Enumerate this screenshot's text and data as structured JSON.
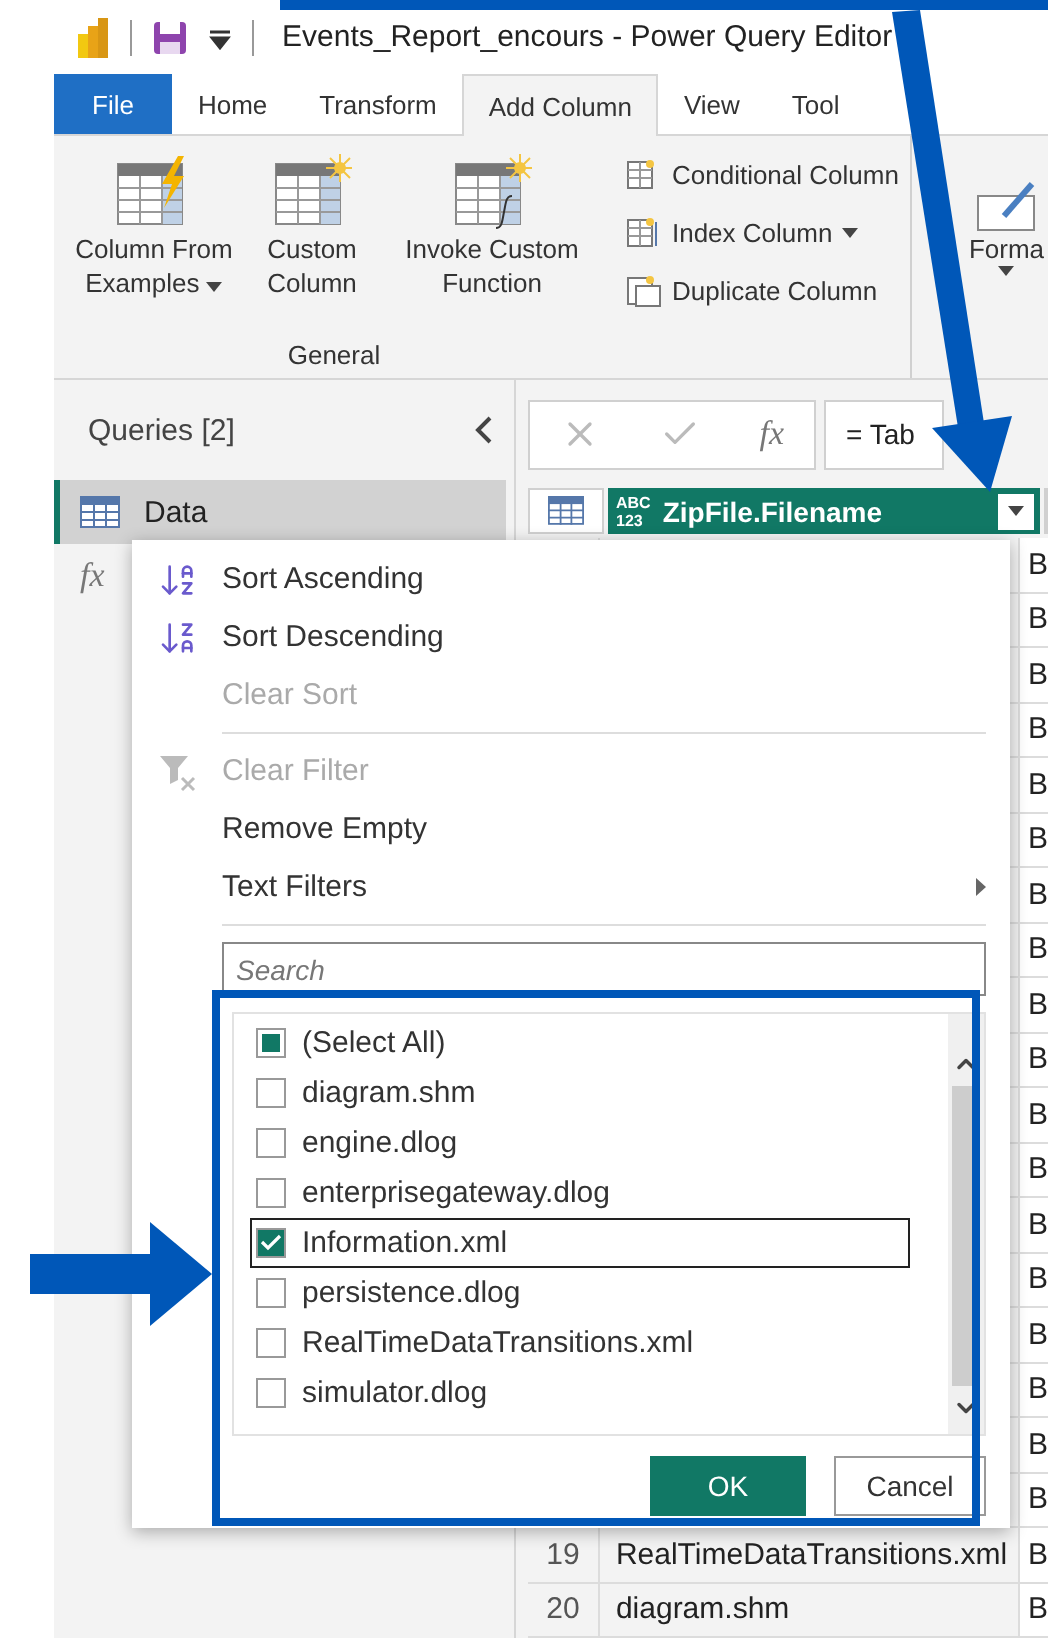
{
  "window": {
    "title": "Events_Report_encours - Power Query Editor"
  },
  "tabs": [
    {
      "label": "File",
      "kind": "file",
      "selected": false
    },
    {
      "label": "Home",
      "kind": "tab",
      "selected": false
    },
    {
      "label": "Transform",
      "kind": "tab",
      "selected": false
    },
    {
      "label": "Add Column",
      "kind": "tab",
      "selected": true
    },
    {
      "label": "View",
      "kind": "tab",
      "selected": false
    },
    {
      "label": "Tool",
      "kind": "tab",
      "selected": false
    }
  ],
  "ribbon": {
    "large_buttons": [
      {
        "label": "Column From Examples",
        "kind": "examples",
        "dropdown": true
      },
      {
        "label": "Custom Column",
        "kind": "custom",
        "dropdown": false
      },
      {
        "label": "Invoke Custom Function",
        "kind": "invoke",
        "dropdown": false
      }
    ],
    "group_label": "General",
    "small_buttons": [
      {
        "label": "Conditional Column",
        "kind": "conditional",
        "dropdown": false
      },
      {
        "label": "Index Column",
        "kind": "index",
        "dropdown": true
      },
      {
        "label": "Duplicate Column",
        "kind": "duplicate",
        "dropdown": false
      }
    ],
    "format_button": {
      "label": "Forma",
      "dropdown": true
    }
  },
  "queries": {
    "title": "Queries [2]",
    "items": [
      {
        "label": "Data",
        "kind": "table",
        "selected": true
      },
      {
        "kind": "function",
        "icon": "fx",
        "selected": false
      }
    ]
  },
  "formula_bar": {
    "function_label": "fx",
    "formula": "= Tab"
  },
  "grid": {
    "column_type": [
      "ABC",
      "123"
    ],
    "column_header": "ZipFile.Filename",
    "rows": [
      {
        "column_2": "B"
      },
      {
        "column_2": "B"
      },
      {
        "column_2": "B"
      },
      {
        "column_2": "B"
      },
      {
        "column_2": "B"
      },
      {
        "column_2": "B"
      },
      {
        "column_2": "B"
      },
      {
        "column_2": "B"
      },
      {
        "column_2": "B"
      },
      {
        "column_2": "B"
      },
      {
        "column_2": "B"
      },
      {
        "column_2": "B"
      },
      {
        "column_2": "B"
      },
      {
        "column_2": "B"
      },
      {
        "column_2": "B"
      },
      {
        "column_2": "B"
      },
      {
        "column_2": "B"
      },
      {
        "column_2": "B"
      },
      {
        "num": "19",
        "filename": "RealTimeDataTransitions.xml",
        "column_2": "B"
      },
      {
        "num": "20",
        "filename": "diagram.shm",
        "column_2": "B"
      }
    ]
  },
  "filter_menu": {
    "items": [
      {
        "label": "Sort Ascending",
        "kind": "sort-asc",
        "disabled": false,
        "submenu": false
      },
      {
        "label": "Sort Descending",
        "kind": "sort-desc",
        "disabled": false,
        "submenu": false
      },
      {
        "label": "Clear Sort",
        "kind": "plain",
        "disabled": true,
        "submenu": false
      },
      {
        "kind": "separator"
      },
      {
        "label": "Clear Filter",
        "kind": "clear-filter",
        "disabled": true,
        "submenu": false
      },
      {
        "label": "Remove Empty",
        "kind": "plain",
        "disabled": false,
        "submenu": false
      },
      {
        "label": "Text Filters",
        "kind": "plain",
        "disabled": false,
        "submenu": true
      },
      {
        "kind": "separator"
      }
    ],
    "search": {
      "placeholder": "Search"
    },
    "values": [
      {
        "label": "(Select All)",
        "checked": true,
        "indeterminate": true,
        "focused": false
      },
      {
        "label": "diagram.shm",
        "checked": false,
        "indeterminate": false,
        "focused": false
      },
      {
        "label": "engine.dlog",
        "checked": false,
        "indeterminate": false,
        "focused": false
      },
      {
        "label": "enterprisegateway.dlog",
        "checked": false,
        "indeterminate": false,
        "focused": false
      },
      {
        "label": "Information.xml",
        "checked": true,
        "indeterminate": false,
        "focused": true
      },
      {
        "label": "persistence.dlog",
        "checked": false,
        "indeterminate": false,
        "focused": false
      },
      {
        "label": "RealTimeDataTransitions.xml",
        "checked": false,
        "indeterminate": false,
        "focused": false
      },
      {
        "label": "simulator.dlog",
        "checked": false,
        "indeterminate": false,
        "focused": false
      }
    ],
    "buttons": [
      {
        "label": "OK",
        "kind": "primary"
      },
      {
        "label": "Cancel",
        "kind": "secondary"
      }
    ]
  }
}
